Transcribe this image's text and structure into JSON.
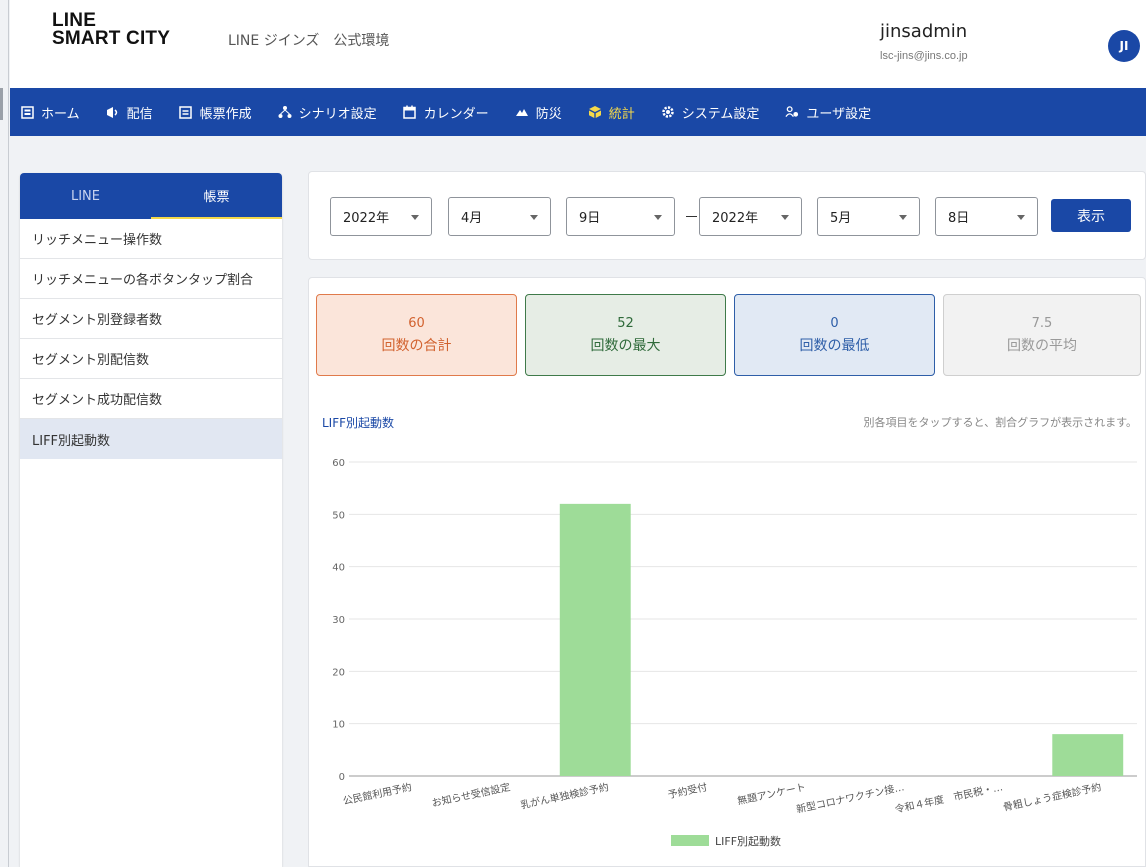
{
  "header": {
    "logo_line1": "LINE",
    "logo_line2": "SMART CITY",
    "environment": "LINE ジインズ　公式環境",
    "user_name": "jinsadmin",
    "user_email": "lsc-jins@jins.co.jp",
    "avatar_initials": "JI"
  },
  "nav": {
    "items": [
      {
        "label": "ホーム",
        "icon": "home-icon"
      },
      {
        "label": "配信",
        "icon": "broadcast-icon"
      },
      {
        "label": "帳票作成",
        "icon": "form-icon"
      },
      {
        "label": "シナリオ設定",
        "icon": "scenario-icon"
      },
      {
        "label": "カレンダー",
        "icon": "calendar-icon"
      },
      {
        "label": "防災",
        "icon": "disaster-icon"
      },
      {
        "label": "統計",
        "icon": "stats-icon"
      },
      {
        "label": "システム設定",
        "icon": "gear-icon"
      },
      {
        "label": "ユーザ設定",
        "icon": "users-icon"
      }
    ],
    "active_index": 6
  },
  "sidebar": {
    "tabs": [
      "LINE",
      "帳票"
    ],
    "active_tab": 1,
    "items": [
      "リッチメニュー操作数",
      "リッチメニューの各ボタンタップ割合",
      "セグメント別登録者数",
      "セグメント別配信数",
      "セグメント成功配信数",
      "LIFF別起動数"
    ],
    "active_item": 5
  },
  "filter": {
    "from_year": "2022年",
    "from_month": "4月",
    "from_day": "9日",
    "to_year": "2022年",
    "to_month": "5月",
    "to_day": "8日",
    "show_button": "表示"
  },
  "stats": {
    "total": {
      "value": "60",
      "label": "回数の合計"
    },
    "max": {
      "value": "52",
      "label": "回数の最大"
    },
    "min": {
      "value": "0",
      "label": "回数の最低"
    },
    "avg": {
      "value": "7.5",
      "label": "回数の平均"
    }
  },
  "chart_data": {
    "type": "bar",
    "title": "LIFF別起動数",
    "hint": "別各項目をタップすると、割合グラフが表示されます。",
    "categories": [
      "公民館利用予約",
      "お知らせ受信設定",
      "乳がん単独検診予約",
      "予約受付",
      "無題アンケート",
      "新型コロナワクチン接…",
      "令和４年度　市民税・…",
      "骨粗しょう症検診予約"
    ],
    "series": [
      {
        "name": "LIFF別起動数",
        "values": [
          0,
          0,
          52,
          0,
          0,
          0,
          0,
          8
        ]
      }
    ],
    "ylim": [
      0,
      60
    ],
    "yticks": [
      0,
      10,
      20,
      30,
      40,
      50,
      60
    ],
    "legend": "bottom",
    "grid": true,
    "bar_color": "#9edc98"
  }
}
